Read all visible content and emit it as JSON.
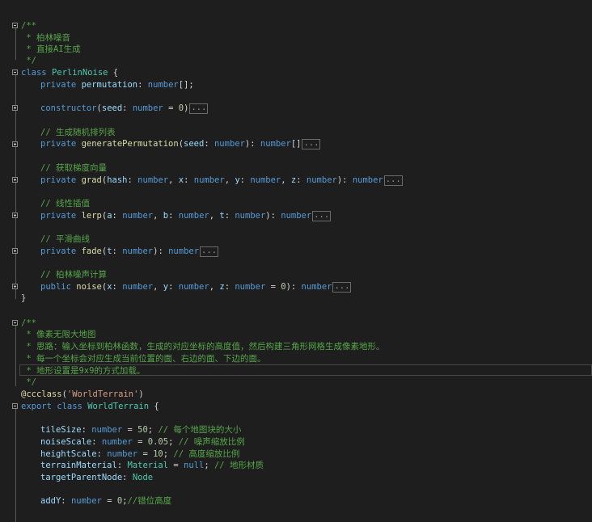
{
  "code": {
    "l01": "/**",
    "l02": " * 柏林噪音",
    "l03": " * 直接AI生成",
    "l04": " */",
    "l05_kw": "class",
    "l05_name": "PerlinNoise",
    "l05_rest": " {",
    "l06_kw": "private",
    "l06_name": "permutation",
    "l06_type": "number",
    "l06_rest": "[];",
    "l07_kw": "constructor",
    "l07_p": "seed",
    "l07_type": "number",
    "l07_eq": " = ",
    "l07_val": "0",
    "l07_close": ")",
    "l08_c": "// 生成随机排列表",
    "l09_kw": "private",
    "l09_fn": "generatePermutation",
    "l09_p": "seed",
    "l09_type": "number",
    "l09_ret": "number",
    "l10_c": "// 获取梯度向量",
    "l11_kw": "private",
    "l11_fn": "grad",
    "l11_params": [
      "hash",
      "x",
      "y",
      "z"
    ],
    "l11_type": "number",
    "l12_c": "// 线性插值",
    "l13_kw": "private",
    "l13_fn": "lerp",
    "l13_params": [
      "a",
      "b",
      "t"
    ],
    "l13_type": "number",
    "l14_c": "// 平滑曲线",
    "l15_kw": "private",
    "l15_fn": "fade",
    "l15_params": [
      "t"
    ],
    "l15_type": "number",
    "l16_c": "// 柏林噪声计算",
    "l17_kw": "public",
    "l17_fn": "noise",
    "l17_params": [
      "x",
      "y",
      "z"
    ],
    "l17_type": "number",
    "l17_default": "0",
    "l18": "}",
    "l19": "/**",
    "l20": " * 像素无限大地图",
    "l21": " * 思路：输入坐标到柏林函数，生成的对应坐标的高度值，然后构建三角形网格生成像素地形。",
    "l22": " * 每一个坐标会对应生成当前位置的面、右边的面、下边的面。",
    "l23": " * 地形设置是9x9的方式加载。",
    "l24": " */",
    "l25_dec": "@ccclass",
    "l25_str": "'WorldTerrain'",
    "l26_kw1": "export",
    "l26_kw2": "class",
    "l26_name": "WorldTerrain",
    "l26_rest": " {",
    "l27_p": "tileSize",
    "l27_type": "number",
    "l27_val": "50",
    "l27_c": "// 每个地图块的大小",
    "l28_p": "noiseScale",
    "l28_type": "number",
    "l28_val": "0.05",
    "l28_c": "// 噪声缩放比例",
    "l29_p": "heightScale",
    "l29_type": "number",
    "l29_val": "10",
    "l29_c": "// 高度缩放比例",
    "l30_p": "terrainMaterial",
    "l30_type": "Material",
    "l30_val": "null",
    "l30_c": "// 地形材质",
    "l31_p": "targetParentNode",
    "l31_type": "Node",
    "l32_p": "addY",
    "l32_type": "number",
    "l32_val": "0",
    "l32_c": "//错位高度",
    "ellipsis": "..."
  }
}
